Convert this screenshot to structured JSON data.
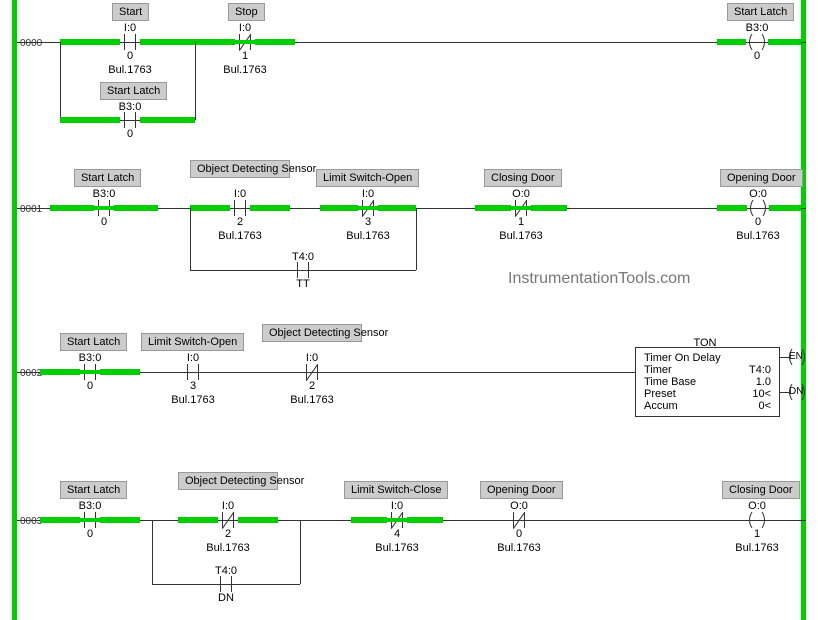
{
  "watermark": "InstrumentationTools.com",
  "rungNumbers": [
    "0000",
    "0001",
    "0002",
    "0003"
  ],
  "bulType": "Bul.1763",
  "rung0": {
    "start": {
      "label": "Start",
      "addr": "I:0",
      "term": "0"
    },
    "stop": {
      "label": "Stop",
      "addr": "I:0",
      "term": "1"
    },
    "latchOut": {
      "label": "Start Latch",
      "addr": "B3:0",
      "term": "0"
    },
    "latchBr": {
      "label": "Start Latch",
      "addr": "B3:0",
      "term": "0"
    }
  },
  "rung1": {
    "latch": {
      "label": "Start Latch",
      "addr": "B3:0",
      "term": "0"
    },
    "sensor": {
      "label": "Object Detecting Sensor",
      "addr": "I:0",
      "term": "2"
    },
    "limitOpen": {
      "label": "Limit Switch-Open",
      "addr": "I:0",
      "term": "3"
    },
    "closingDoor": {
      "label": "Closing Door",
      "addr": "O:0",
      "term": "1"
    },
    "openingDoor": {
      "label": "Opening Door",
      "addr": "O:0",
      "term": "0"
    },
    "timer": {
      "addr": "T4:0",
      "term": "TT"
    }
  },
  "rung2": {
    "latch": {
      "label": "Start Latch",
      "addr": "B3:0",
      "term": "0"
    },
    "limitOpen": {
      "label": "Limit Switch-Open",
      "addr": "I:0",
      "term": "3"
    },
    "sensor": {
      "label": "Object Detecting Sensor",
      "addr": "I:0",
      "term": "2"
    },
    "timer": {
      "title": "TON",
      "line1": "Timer On Delay",
      "timerLbl": "Timer",
      "timerVal": "T4:0",
      "baseLbl": "Time Base",
      "baseVal": "1.0",
      "presetLbl": "Preset",
      "presetVal": "10<",
      "accumLbl": "Accum",
      "accumVal": "0<",
      "en": "EN",
      "dn": "DN"
    }
  },
  "rung3": {
    "latch": {
      "label": "Start Latch",
      "addr": "B3:0",
      "term": "0"
    },
    "sensor": {
      "label": "Object Detecting Sensor",
      "addr": "I:0",
      "term": "2"
    },
    "limitClose": {
      "label": "Limit Switch-Close",
      "addr": "I:0",
      "term": "4"
    },
    "openingDoor": {
      "label": "Opening Door",
      "addr": "O:0",
      "term": "0"
    },
    "closingDoor": {
      "label": "Closing Door",
      "addr": "O:0",
      "term": "1"
    },
    "timer": {
      "addr": "T4:0",
      "term": "DN"
    }
  }
}
